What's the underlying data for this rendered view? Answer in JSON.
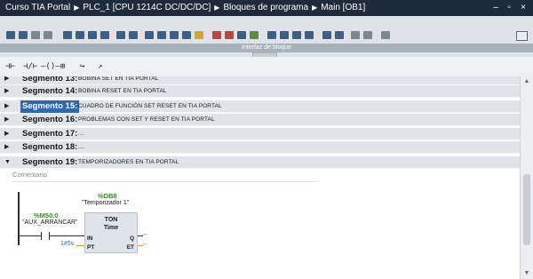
{
  "titlebar": {
    "project": "Curso TIA Portal",
    "plc": "PLC_1 [CPU 1214C DC/DC/DC]",
    "folder": "Bloques de programa",
    "block": "Main [OB1]",
    "minimize": "–",
    "restore": "▫",
    "close": "×"
  },
  "toolbar": {
    "interface_label": "Interfaz de bloque"
  },
  "palette": {
    "items": [
      "⊣⊢",
      "⊣/⊢",
      "–()–",
      "⊞",
      "↪",
      "↗"
    ]
  },
  "segments": [
    {
      "label": "Segmento 13:",
      "desc": "BOBINA SET EN TIA PORTAL",
      "expanded": false
    },
    {
      "label": "Segmento 14:",
      "desc": "BOBINA RESET EN TIA PORTAL",
      "expanded": false
    },
    {
      "label": "Segmento 15:",
      "desc": "CUADRO DE FUNCIÓN SET RESET EN TIA PORTAL",
      "expanded": false,
      "selected": true
    },
    {
      "label": "Segmento 16:",
      "desc": "PROBLEMAS CON SET Y RESET EN TIA PORTAL",
      "expanded": false
    },
    {
      "label": "Segmento 17:",
      "desc": "....",
      "expanded": false
    },
    {
      "label": "Segmento 18:",
      "desc": "....",
      "expanded": false
    },
    {
      "label": "Segmento 19:",
      "desc": "TEMPORIZADORES EN TIA PORTAL",
      "expanded": true
    }
  ],
  "network": {
    "comment_placeholder": "Comentario",
    "contact": {
      "address": "%M50.0",
      "name": "\"AUX_ARRANCAR\""
    },
    "timer": {
      "db_address": "%DB8",
      "db_name": "\"Temporizador 1\"",
      "type": "TON",
      "subtype": "Time",
      "pin_in": "IN",
      "pin_pt": "PT",
      "pin_q": "Q",
      "pin_et": "ET",
      "pt_value": "1#5s",
      "q_out": "...",
      "et_out": "..."
    }
  },
  "colors": {
    "titlebar": "#1d2b3a",
    "segment_header": "#e0e3e7",
    "selection": "#2f67b1",
    "tag_green": "#3b8a2c"
  }
}
